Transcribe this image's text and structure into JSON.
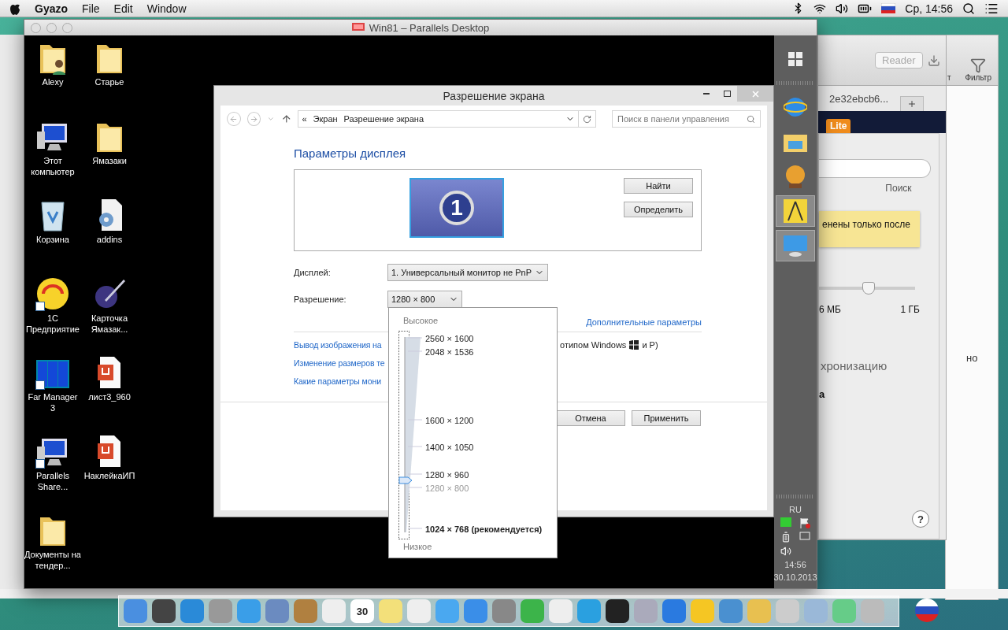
{
  "menubar": {
    "app": "Gyazo",
    "menus": [
      "File",
      "Edit",
      "Window"
    ],
    "clock": "Ср, 14:56"
  },
  "vm_window": {
    "title": "Win81 – Parallels Desktop"
  },
  "desktop_icons": [
    {
      "label": "Alexy",
      "kind": "user-folder",
      "shortcut": false
    },
    {
      "label": "Старье",
      "kind": "folder",
      "shortcut": false
    },
    {
      "label": "Этот компьютер",
      "kind": "computer",
      "shortcut": false
    },
    {
      "label": "Ямазаки",
      "kind": "folder",
      "shortcut": false
    },
    {
      "label": "Корзина",
      "kind": "trash",
      "shortcut": false
    },
    {
      "label": "addins",
      "kind": "settings-file",
      "shortcut": false
    },
    {
      "label": "1С Предприятие",
      "kind": "app-circle",
      "shortcut": true
    },
    {
      "label": "Карточка Ямазак...",
      "kind": "pen",
      "shortcut": false
    },
    {
      "label": "Far Manager 3",
      "kind": "panels",
      "shortcut": true
    },
    {
      "label": "лист3_960",
      "kind": "pdf",
      "shortcut": false
    },
    {
      "label": "Parallels Share...",
      "kind": "computer",
      "shortcut": true
    },
    {
      "label": "НаклейкаИП",
      "kind": "pdf",
      "shortcut": false
    },
    {
      "label": "Документы на тендер...",
      "kind": "folder",
      "shortcut": false
    }
  ],
  "dialog": {
    "title": "Разрешение экрана",
    "breadcrumb": [
      "«",
      "Экран",
      "Разрешение экрана"
    ],
    "search_placeholder": "Поиск в панели управления",
    "heading": "Параметры дисплея",
    "monitor_number": "1",
    "side_buttons": [
      "Найти",
      "Определить"
    ],
    "display_label": "Дисплей:",
    "display_value": "1. Универсальный монитор не PnP",
    "resolution_label": "Разрешение:",
    "resolution_value": "1280 × 800",
    "advanced_link": "Дополнительные параметры",
    "links": [
      {
        "text": "Вывод изображения на",
        "tail": "отипом Windows",
        "tail_end": "и P)"
      },
      {
        "text": "Изменение размеров те"
      },
      {
        "text": "Какие параметры мони"
      }
    ],
    "footer_buttons": [
      "Отмена",
      "Применить"
    ]
  },
  "resolution_popup": {
    "high": "Высокое",
    "low": "Низкое",
    "level": 0.25,
    "options": [
      {
        "label": "2560 × 1600",
        "selected": false,
        "recommended": false
      },
      {
        "label": "2048 × 1536",
        "selected": false,
        "recommended": false
      },
      {
        "label": "1600 × 1200",
        "selected": false,
        "recommended": false
      },
      {
        "label": "1400 × 1050",
        "selected": false,
        "recommended": false
      },
      {
        "label": "1280 × 960",
        "selected": false,
        "recommended": false
      },
      {
        "label": "1280 × 800",
        "selected": true,
        "recommended": false
      },
      {
        "label": "1024 × 768 (рекомендуется)",
        "selected": false,
        "recommended": true
      }
    ]
  },
  "win_taskbar": {
    "language": "RU",
    "time": "14:56",
    "date": "30.10.2013"
  },
  "background_window": {
    "tab_title": "2e32ebcb6...",
    "reader": "Reader",
    "badge": "Lite",
    "search_label": "Поиск",
    "note": "енены только после",
    "slider_min": "6 МБ",
    "slider_max": "1 ГБ",
    "option_text": "хронизацию",
    "option_text_2": "а",
    "help": "?"
  },
  "far_window": {
    "toolbar_label": "Фильтр",
    "toolbar_cut": "т",
    "body_text": "но"
  },
  "dock": {
    "calendar_day": "30"
  }
}
